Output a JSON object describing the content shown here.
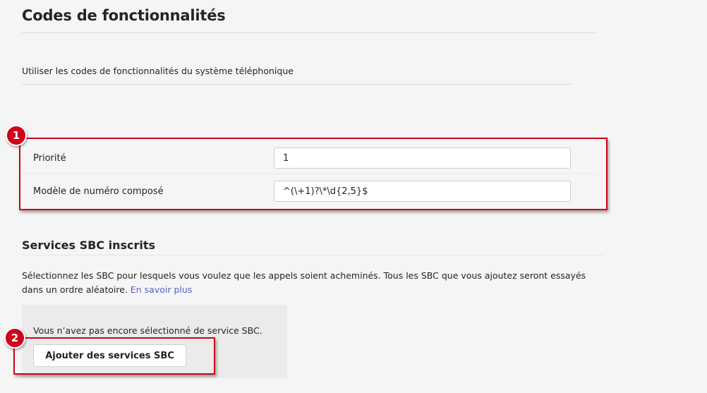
{
  "header": {
    "title": "Codes de fonctionnalités"
  },
  "feature_codes": {
    "label": "Utiliser les codes de fonctionnalités du système téléphonique"
  },
  "form": {
    "priority": {
      "label": "Priorité",
      "value": "1"
    },
    "dial_pattern": {
      "label": "Modèle de numéro composé",
      "value": "^(\\+1)?\\*\\d{2,5}$"
    }
  },
  "sbc": {
    "title": "Services SBC inscrits",
    "description": "Sélectionnez les SBC pour lesquels vous voulez que les appels soient acheminés. Tous les SBC que vous ajoutez seront essayés dans un ordre aléatoire.",
    "learn_more": "En savoir plus",
    "empty_message": "Vous n’avez pas encore sélectionné de service SBC.",
    "add_button": "Ajouter des services SBC"
  },
  "annotations": {
    "badge_1": "1",
    "badge_2": "2",
    "color": "#d0021b"
  }
}
